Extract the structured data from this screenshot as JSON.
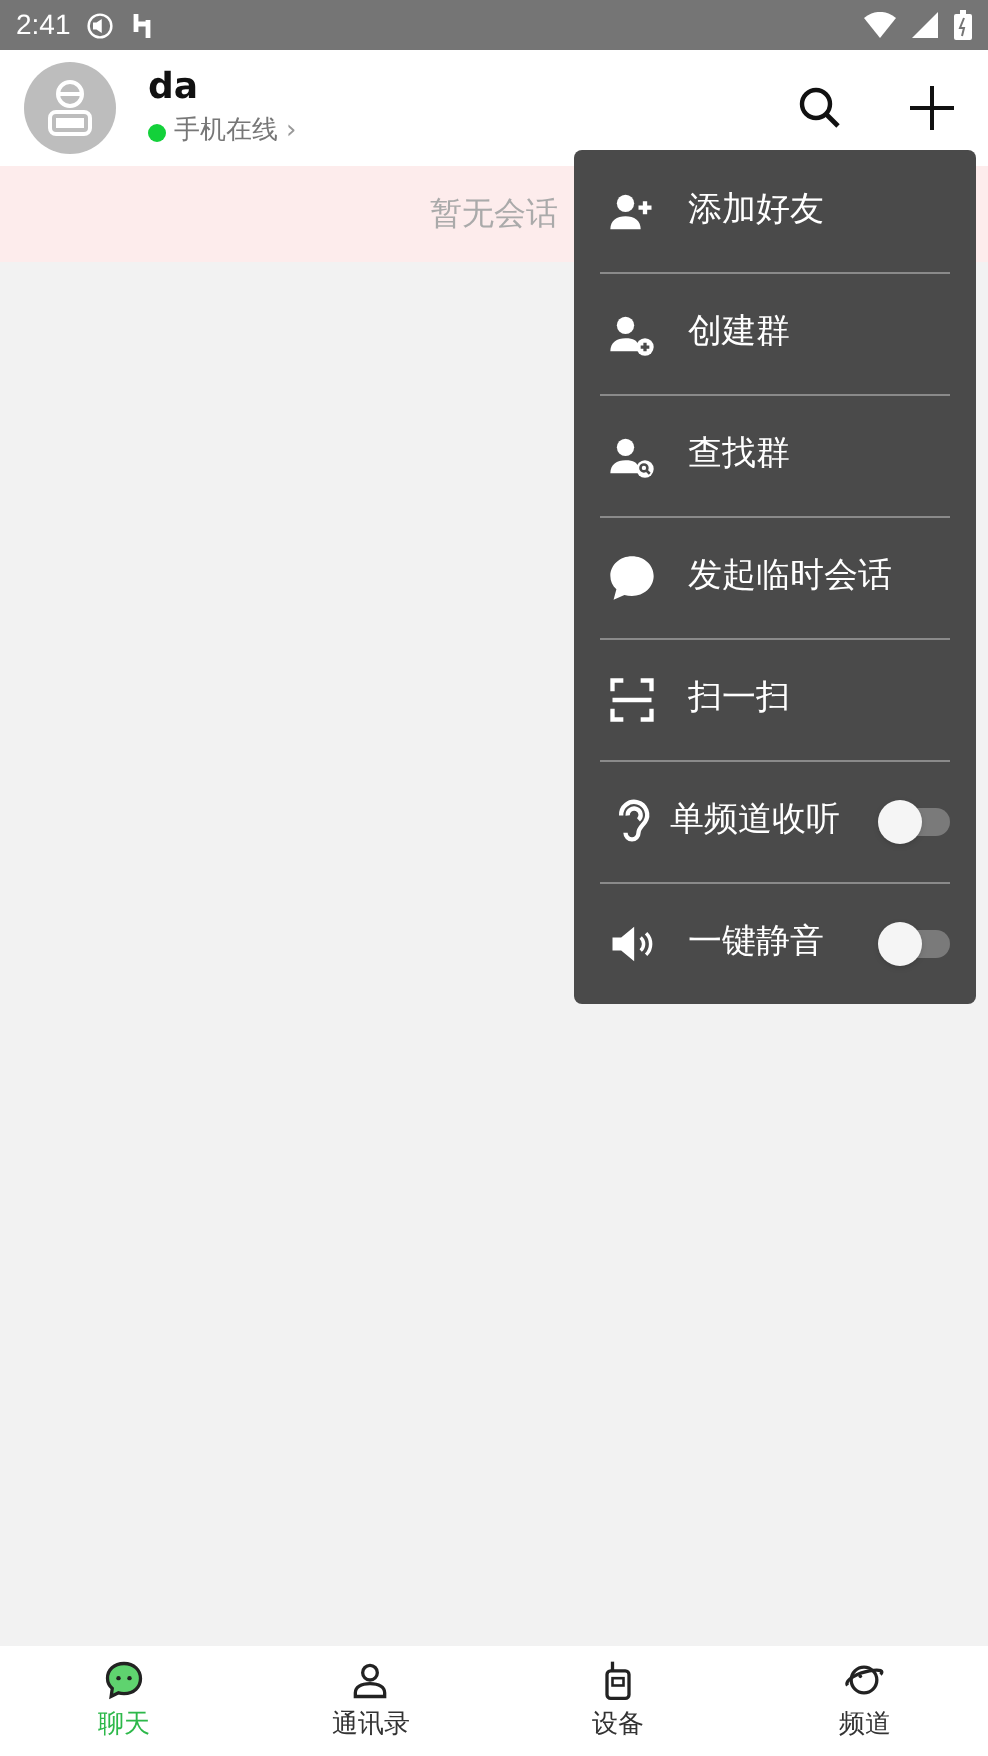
{
  "status_bar": {
    "time": "2:41"
  },
  "header": {
    "name": "da",
    "status": "手机在线",
    "online": true,
    "status_arrow": "›"
  },
  "banner": {
    "text": "暂无会话"
  },
  "menu": {
    "items": [
      {
        "kind": "action",
        "label": "添加好友"
      },
      {
        "kind": "action",
        "label": "创建群"
      },
      {
        "kind": "action",
        "label": "查找群"
      },
      {
        "kind": "action",
        "label": "发起临时会话"
      },
      {
        "kind": "action",
        "label": "扫一扫"
      },
      {
        "kind": "toggle",
        "label": "单频道收听",
        "on": false
      },
      {
        "kind": "toggle",
        "label": "一键静音",
        "on": false
      }
    ]
  },
  "tabs": [
    {
      "label": "聊天",
      "selected": true
    },
    {
      "label": "通讯录",
      "selected": false
    },
    {
      "label": "设备",
      "selected": false
    },
    {
      "label": "频道",
      "selected": false
    }
  ]
}
